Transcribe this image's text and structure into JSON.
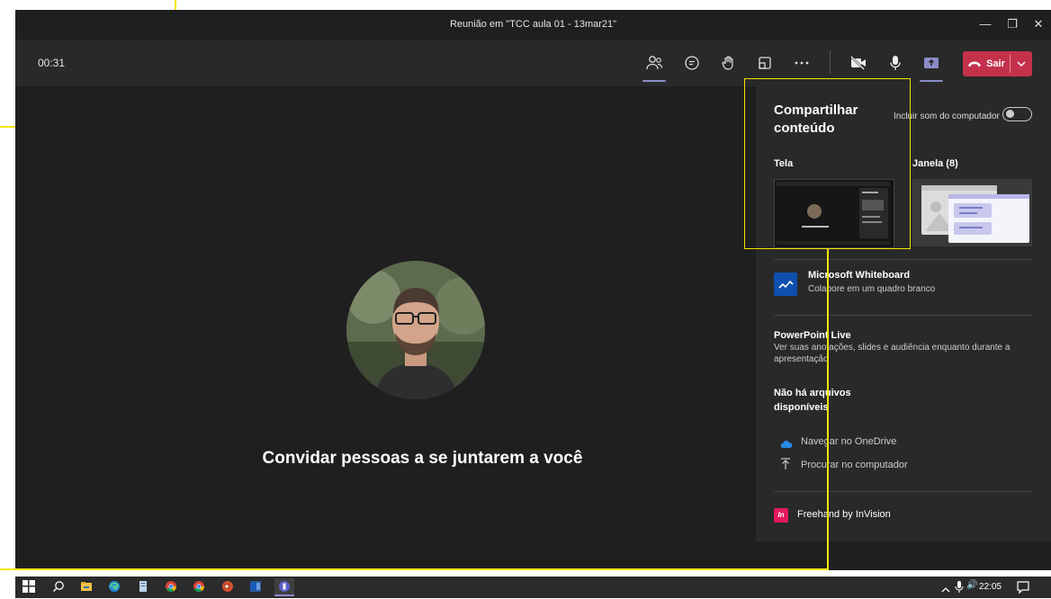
{
  "window": {
    "title": "Reunião em \"TCC aula 01 - 13mar21\"",
    "minimize_glyph": "—",
    "maximize_glyph": "❐",
    "close_glyph": "✕"
  },
  "toolbar": {
    "timer": "00:31",
    "buttons": [
      "people-icon",
      "chat-icon",
      "raise-hand-icon",
      "rooms-icon",
      "more-icon",
      "camera-off-icon",
      "mic-icon",
      "share-icon"
    ],
    "leave_label": "Sair"
  },
  "stage": {
    "invite_text": "Convidar pessoas a se juntarem a você"
  },
  "share_panel": {
    "title": "Compartilhar conteúdo",
    "include_sound_label": "Incluir som do computador",
    "include_sound_on": false,
    "screen_label": "Tela",
    "window_label": "Janela (8)",
    "whiteboard": {
      "title": "Microsoft Whiteboard",
      "subtitle": "Colabore em um quadro branco"
    },
    "powerpoint": {
      "title": "PowerPoint Live",
      "subtitle": "Ver suas anotações, slides e audiência enquanto durante a apresentação"
    },
    "no_files": "Não há arquivos disponíveis",
    "onedrive_label": "Navegar no OneDrive",
    "computer_label": "Procurar no computador",
    "freehand_label": "Freehand by InVision",
    "freehand_icon_text": "In"
  },
  "taskbar": {
    "clock": "22:05",
    "volume_glyph": "🔊"
  },
  "colors": {
    "accent": "#8b8cc7",
    "leave": "#c4314b",
    "highlight": "#f5e500"
  }
}
